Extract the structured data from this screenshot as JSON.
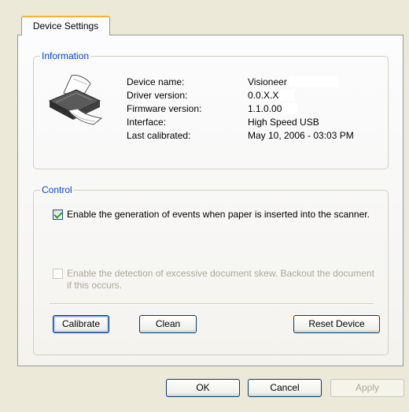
{
  "tab": {
    "label": "Device Settings"
  },
  "information": {
    "title": "Information",
    "rows": [
      {
        "label": "Device name:",
        "value": "Visioneer"
      },
      {
        "label": "Driver version:",
        "value": "0.0.X.X"
      },
      {
        "label": "Firmware version:",
        "value": "1.1.0.00"
      },
      {
        "label": "Interface:",
        "value": "High Speed USB"
      },
      {
        "label": "Last calibrated:",
        "value": "May 10, 2006 - 03:03 PM"
      }
    ]
  },
  "control": {
    "title": "Control",
    "events_checkbox": {
      "checked": true,
      "label": "Enable the generation of events when paper is inserted into the scanner."
    },
    "skew_checkbox": {
      "checked": false,
      "enabled": false,
      "label": "Enable the detection of excessive document skew. Backout the document if this occurs."
    },
    "calibrate_label": "Calibrate",
    "clean_label": "Clean",
    "reset_label": "Reset Device"
  },
  "footer": {
    "ok_label": "OK",
    "cancel_label": "Cancel",
    "apply_label": "Apply"
  }
}
